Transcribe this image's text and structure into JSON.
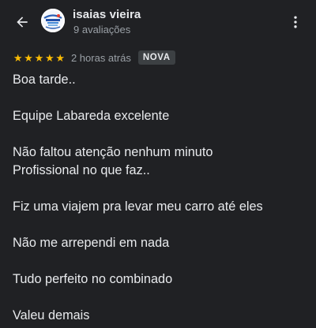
{
  "header": {
    "reviewer_name": "isaias vieira",
    "review_count": "9 avaliações",
    "back_icon": "arrow-back-icon",
    "more_icon": "more-vert-icon"
  },
  "review": {
    "rating": 5,
    "max_rating": 5,
    "time": "2 horas atrás",
    "badge": "NOVA",
    "star_color": "#fbbc04",
    "paragraphs": [
      [
        "Boa tarde.."
      ],
      [
        "Equipe Labareda excelente"
      ],
      [
        "Não faltou atenção nenhum minuto",
        "Profissional no que faz.."
      ],
      [
        "Fiz uma viajem pra levar meu carro até eles"
      ],
      [
        "Não me arrependi em nada"
      ],
      [
        "Tudo perfeito no combinado"
      ],
      [
        "Valeu demais"
      ]
    ]
  },
  "colors": {
    "background": "#202124",
    "text_primary": "#e8eaed",
    "text_secondary": "#9aa0a6",
    "badge_bg": "#3c4043"
  }
}
